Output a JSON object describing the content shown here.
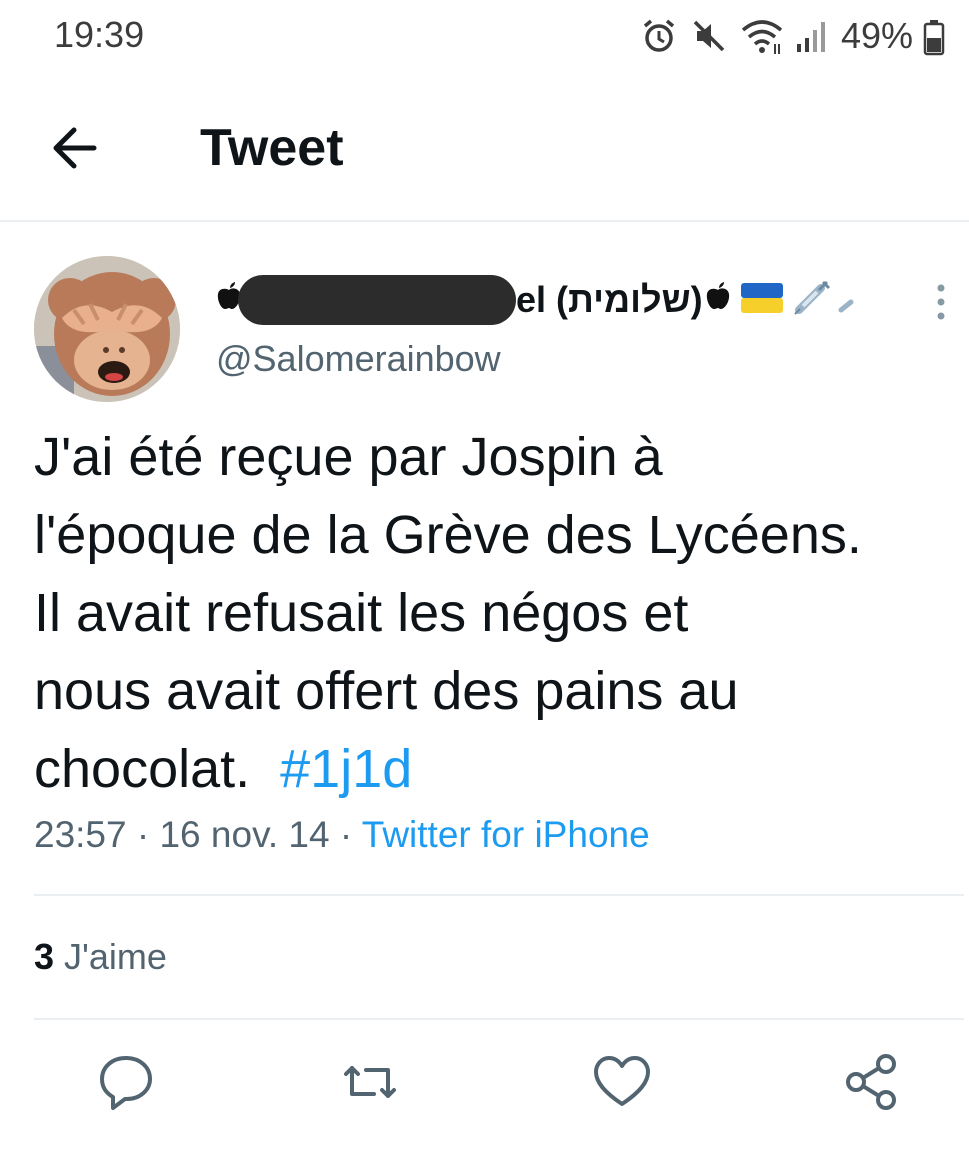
{
  "status_bar": {
    "time": "19:39",
    "battery": "49%",
    "icons": [
      "alarm-icon",
      "mute-icon",
      "wifi-icon",
      "signal-icon",
      "battery-icon"
    ]
  },
  "header": {
    "title": "Tweet",
    "back_icon": "arrow-left-icon"
  },
  "tweet": {
    "author": {
      "display_name_visible": "el (שלומית)",
      "handle": "@Salomerainbow",
      "name_emojis": [
        "apple-emoji",
        "ukraine-flag-emoji",
        "syringe-emoji"
      ]
    },
    "text_lines": [
      "J'ai été reçue par Jospin à",
      "l'époque de la Grève des Lycéens.",
      "Il avait refusait les négos et",
      "nous avait offert des pains au"
    ],
    "text_last_prefix": "chocolat.  ",
    "hashtag": "#1j1d",
    "time": "23:57",
    "date": "16 nov. 14",
    "separator": " · ",
    "client": "Twitter for iPhone",
    "likes_count": "3",
    "likes_label": " J'aime"
  },
  "actions": [
    "reply-icon",
    "retweet-icon",
    "like-icon",
    "share-icon"
  ],
  "colors": {
    "accent": "#1d9bf0",
    "text": "#0f1419",
    "secondary": "#536471",
    "divider": "#eceff1"
  }
}
